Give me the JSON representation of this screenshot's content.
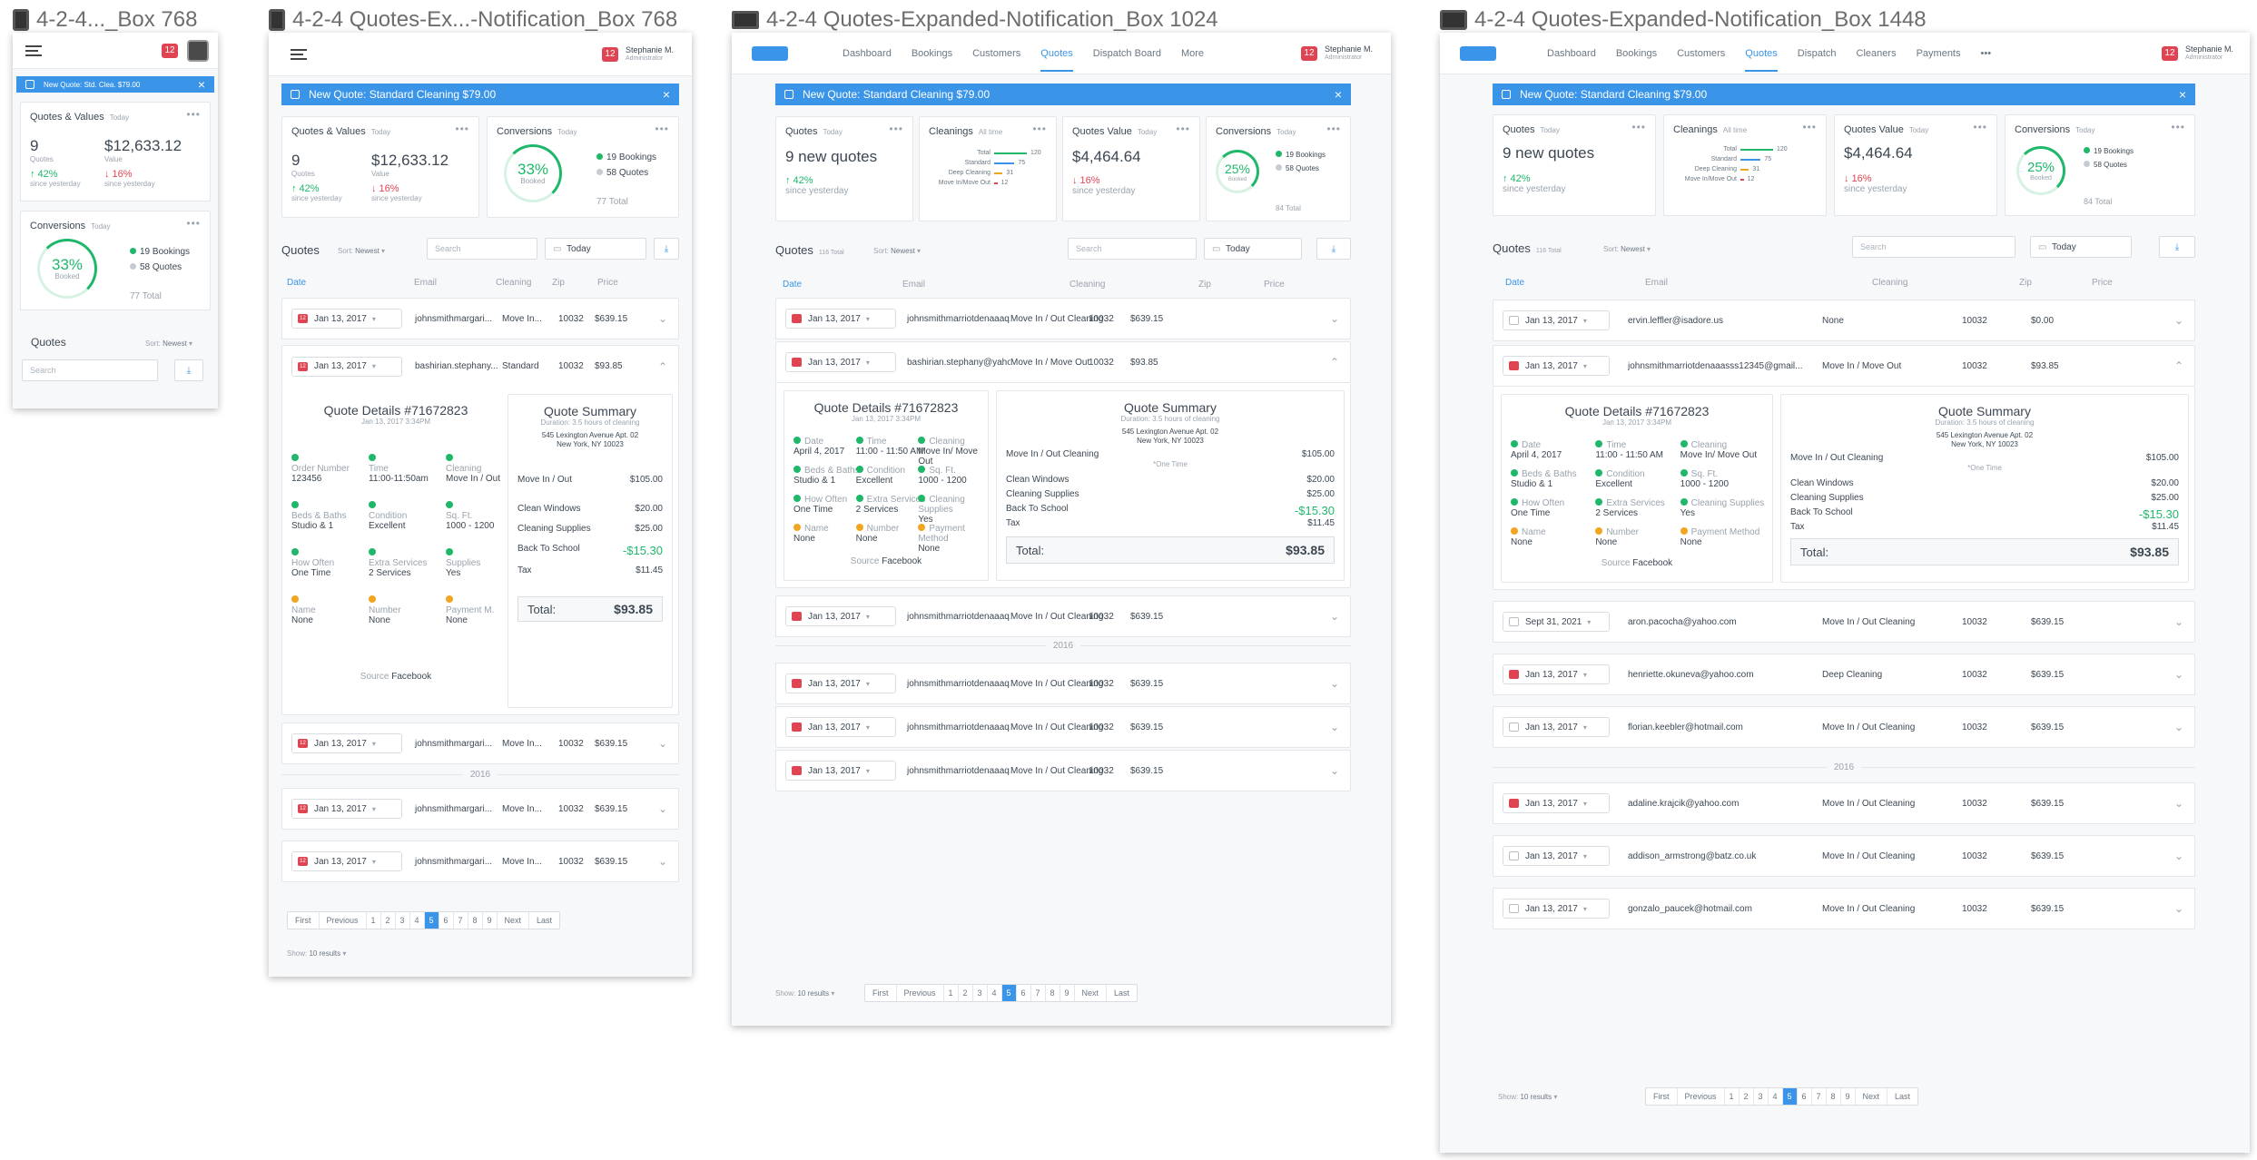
{
  "artboards": [
    {
      "label": "4-2-4..._Box 768"
    },
    {
      "label": "4-2-4 Quotes-Ex...-Notification_Box 768"
    },
    {
      "label": "4-2-4 Quotes-Expanded-Notification_Box 1024"
    },
    {
      "label": "4-2-4 Quotes-Expanded-Notification_Box 1448"
    }
  ],
  "user": {
    "name": "Stephanie M.",
    "role": "Administrator",
    "notif_count": "12"
  },
  "nav1024": [
    "Dashboard",
    "Bookings",
    "Customers",
    "Quotes",
    "Dispatch Board",
    "More"
  ],
  "nav1448": [
    "Dashboard",
    "Bookings",
    "Customers",
    "Quotes",
    "Dispatch",
    "Cleaners",
    "Payments",
    "•••"
  ],
  "banner_short": "New Quote: Std. Clea. $79.00",
  "banner": "New Quote: Standard Cleaning $79.00",
  "qv": {
    "title": "Quotes & Values",
    "when": "Today",
    "quotes": "9",
    "quotes_lbl": "Quotes",
    "value": "$12,633.12",
    "value_lbl": "Value",
    "up": "↑ 42%",
    "down": "↓ 16%",
    "since": "since yesterday"
  },
  "conv": {
    "title": "Conversions",
    "when": "Today",
    "pct": "33%",
    "pct2": "25%",
    "booked": "Booked",
    "bookings": "19 Bookings",
    "quotes": "58 Quotes",
    "total": "77 Total",
    "total2": "84 Total"
  },
  "quotes_card": {
    "title": "Quotes",
    "when": "Today",
    "value": "9 new quotes",
    "up": "↑ 42%",
    "since": "since yesterday"
  },
  "cleanings": {
    "title": "Cleanings",
    "when": "All time",
    "rows": [
      {
        "n": "Total",
        "v": "120"
      },
      {
        "n": "Standard",
        "v": "75"
      },
      {
        "n": "Deep Cleaning",
        "v": "31"
      },
      {
        "n": "Move In/Move Out",
        "v": "12"
      }
    ]
  },
  "qvalue": {
    "title": "Quotes Value",
    "when": "Today",
    "value": "$4,464.64",
    "down": "↓ 16%",
    "since": "since yesterday"
  },
  "list": {
    "title": "Quotes",
    "count": "116 Total",
    "sort_lbl": "Sort:",
    "sort": "Newest",
    "search": "Search",
    "date": "Today",
    "dl": "⤓"
  },
  "cols": {
    "date": "Date",
    "email": "Email",
    "cleaning": "Cleaning",
    "zip": "Zip",
    "price": "Price"
  },
  "year": "2016",
  "rows768": [
    {
      "date": "Jan 13, 2017",
      "email": "johnsmithmargari...",
      "clean": "Move In...",
      "zip": "10032",
      "price": "$639.15"
    },
    {
      "date": "Jan 13, 2017",
      "email": "bashirian.stephany...",
      "clean": "Standard",
      "zip": "10032",
      "price": "$93.85"
    },
    {
      "date": "Jan 13, 2017",
      "email": "johnsmithmargari...",
      "clean": "Move In...",
      "zip": "10032",
      "price": "$639.15"
    },
    {
      "date": "Jan 13, 2017",
      "email": "johnsmithmargari...",
      "clean": "Move In...",
      "zip": "10032",
      "price": "$639.15"
    },
    {
      "date": "Jan 13, 2017",
      "email": "johnsmithmargari...",
      "clean": "Move In...",
      "zip": "10032",
      "price": "$639.15"
    }
  ],
  "rows1024": [
    {
      "date": "Jan 13, 2017",
      "email": "johnsmithmarriotdenaaaq12...",
      "clean": "Move In / Out Cleaning",
      "zip": "10032",
      "price": "$639.15"
    },
    {
      "date": "Jan 13, 2017",
      "email": "bashirian.stephany@yahoo.c...",
      "clean": "Move In / Move Out",
      "zip": "10032",
      "price": "$93.85"
    },
    {
      "date": "Jan 13, 2017",
      "email": "johnsmithmarriotdenaaaq12...",
      "clean": "Move In / Out Cleaning",
      "zip": "10032",
      "price": "$639.15"
    },
    {
      "date": "Jan 13, 2017",
      "email": "johnsmithmarriotdenaaaq12...",
      "clean": "Move In / Out Cleaning",
      "zip": "10032",
      "price": "$639.15"
    },
    {
      "date": "Jan 13, 2017",
      "email": "johnsmithmarriotdenaaaq12...",
      "clean": "Move In / Out Cleaning",
      "zip": "10032",
      "price": "$639.15"
    },
    {
      "date": "Jan 13, 2017",
      "email": "johnsmithmarriotdenaaaq12...",
      "clean": "Move In / Out Cleaning",
      "zip": "10032",
      "price": "$639.15"
    }
  ],
  "rows1448": [
    {
      "date": "Jan 13, 2017",
      "email": "ervin.leffler@isadore.us",
      "clean": "None",
      "zip": "10032",
      "price": "$0.00"
    },
    {
      "date": "Jan 13, 2017",
      "email": "johnsmithmarriotdenaaasss12345@gmail...",
      "clean": "Move In / Move Out",
      "zip": "10032",
      "price": "$93.85"
    },
    {
      "date": "Sept 31, 2021",
      "email": "aron.pacocha@yahoo.com",
      "clean": "Move In / Out Cleaning",
      "zip": "10032",
      "price": "$639.15"
    },
    {
      "date": "Jan 13, 2017",
      "email": "henriette.okuneva@yahoo.com",
      "clean": "Deep Cleaning",
      "zip": "10032",
      "price": "$639.15"
    },
    {
      "date": "Jan 13, 2017",
      "email": "florian.keebler@hotmail.com",
      "clean": "Move In / Out Cleaning",
      "zip": "10032",
      "price": "$639.15"
    },
    {
      "date": "Jan 13, 2017",
      "email": "adaline.krajcik@yahoo.com",
      "clean": "Move In / Out Cleaning",
      "zip": "10032",
      "price": "$639.15"
    },
    {
      "date": "Jan 13, 2017",
      "email": "addison_armstrong@batz.co.uk",
      "clean": "Move In / Out Cleaning",
      "zip": "10032",
      "price": "$639.15"
    },
    {
      "date": "Jan 13, 2017",
      "email": "gonzalo_paucek@hotmail.com",
      "clean": "Move In / Out Cleaning",
      "zip": "10032",
      "price": "$639.15"
    }
  ],
  "details": {
    "title": "Quote Details #71672823",
    "date": "Jan 13, 2017 3:34PM",
    "source_lbl": "Source",
    "source": "Facebook",
    "fields768": [
      {
        "l": "Order Number",
        "v": "123456"
      },
      {
        "l": "Time",
        "v": "11:00-11:50am"
      },
      {
        "l": "Cleaning",
        "v": "Move In / Out"
      },
      {
        "l": "Beds & Baths",
        "v": "Studio & 1"
      },
      {
        "l": "Condition",
        "v": "Excellent"
      },
      {
        "l": "Sq. Ft.",
        "v": "1000 - 1200"
      },
      {
        "l": "How Often",
        "v": "One Time"
      },
      {
        "l": "Extra Services",
        "v": "2 Services"
      },
      {
        "l": "Supplies",
        "v": "Yes"
      },
      {
        "l": "Name",
        "v": "None"
      },
      {
        "l": "Number",
        "v": "None"
      },
      {
        "l": "Payment M.",
        "v": "None"
      }
    ],
    "fields": [
      {
        "l": "Date",
        "v": "April 4, 2017"
      },
      {
        "l": "Time",
        "v": "11:00 - 11:50 AM"
      },
      {
        "l": "Cleaning",
        "v": "Move In/ Move Out"
      },
      {
        "l": "Beds & Baths",
        "v": "Studio & 1"
      },
      {
        "l": "Condition",
        "v": "Excellent"
      },
      {
        "l": "Sq. Ft.",
        "v": "1000 - 1200"
      },
      {
        "l": "How Often",
        "v": "One Time"
      },
      {
        "l": "Extra Services",
        "v": "2 Services"
      },
      {
        "l": "Cleaning Supplies",
        "v": "Yes"
      },
      {
        "l": "Name",
        "v": "None"
      },
      {
        "l": "Number",
        "v": "None"
      },
      {
        "l": "Payment Method",
        "v": "None"
      }
    ]
  },
  "summary": {
    "title": "Quote Summary",
    "duration": "Duration: 3.5 hours of cleaning",
    "addr1": "545 Lexington Avenue Apt. 02",
    "addr2": "New York, NY 10023",
    "onetime": "*One Time",
    "lines": [
      {
        "l": "Move In / Out Cleaning",
        "v": "$105.00"
      },
      {
        "l": "Clean Windows",
        "v": "$20.00"
      },
      {
        "l": "Cleaning Supplies",
        "v": "$25.00"
      },
      {
        "l": "Back To School",
        "v": "-$15.30"
      },
      {
        "l": "Tax",
        "v": "$11.45"
      }
    ],
    "short_first": "Move In / Out",
    "total_lbl": "Total:",
    "total": "$93.85"
  },
  "pager": {
    "first": "First",
    "prev": "Previous",
    "pages": [
      "1",
      "2",
      "3",
      "4",
      "5",
      "6",
      "7",
      "8",
      "9"
    ],
    "active": "5",
    "next": "Next",
    "last": "Last",
    "show_lbl": "Show:",
    "show": "10 results"
  }
}
